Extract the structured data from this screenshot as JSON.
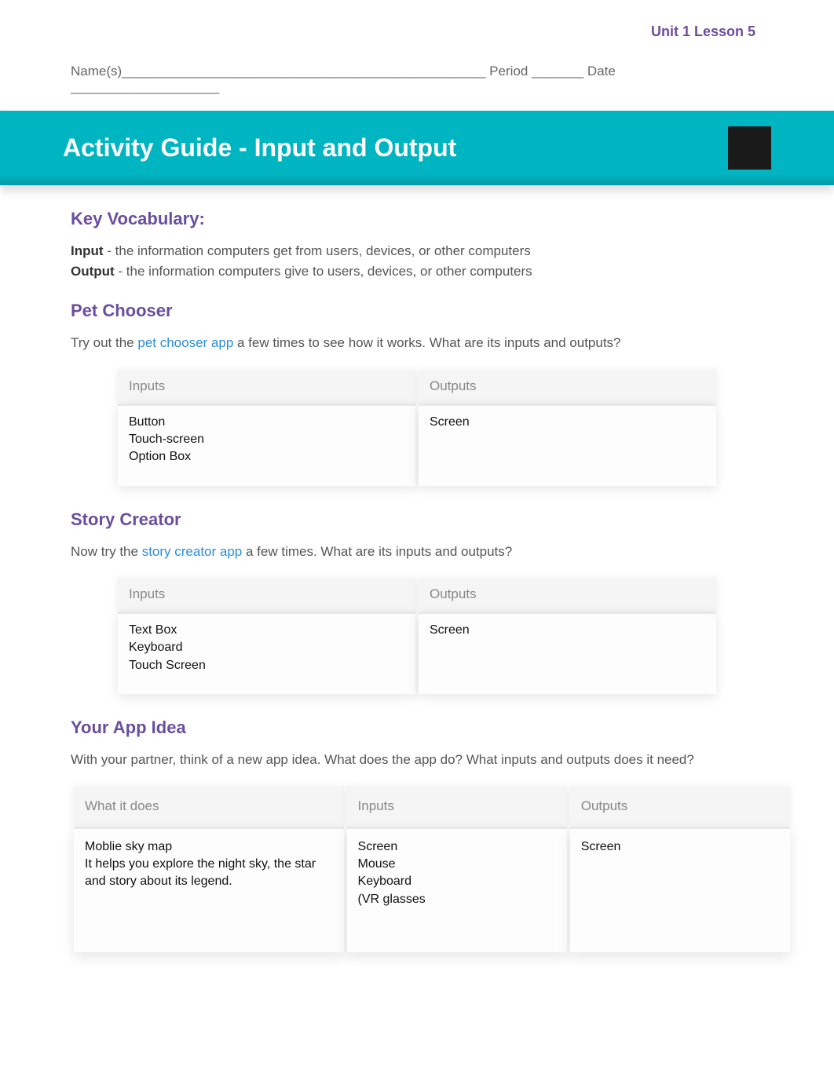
{
  "meta": {
    "unit_lesson": "Unit 1 Lesson 5",
    "name_line": "Name(s)_________________________________________________ Period _______ Date ____________________"
  },
  "title": "Activity Guide - Input and Output",
  "vocab": {
    "heading": "Key Vocabulary:",
    "input_term": "Input",
    "input_def": " - the information computers get from users, devices, or other computers",
    "output_term": "Output",
    "output_def": " - the information computers give to users, devices, or other computers"
  },
  "pet": {
    "heading": "Pet Chooser",
    "pre": "Try out the ",
    "link": "pet chooser app",
    "post": " a few times to see how it works. What are its inputs and outputs?",
    "inputs_header": "Inputs",
    "outputs_header": "Outputs",
    "inputs_body": "Button\nTouch-screen\nOption Box",
    "outputs_body": "Screen"
  },
  "story": {
    "heading": "Story Creator",
    "pre": "Now try the ",
    "link": "story creator app",
    "post": " a few times. What are its inputs and outputs?",
    "inputs_header": "Inputs",
    "outputs_header": "Outputs",
    "inputs_body": "Text Box\nKeyboard\nTouch Screen",
    "outputs_body": "Screen"
  },
  "idea": {
    "heading": "Your App Idea",
    "prompt": "With your partner, think of a new app idea. What does the app do? What inputs and outputs does it need?",
    "what_header": "What it does",
    "inputs_header": "Inputs",
    "outputs_header": "Outputs",
    "what_body": "Moblie  sky map\nIt helps you explore the night sky, the star and story about its legend.",
    "inputs_body": "Screen\nMouse\nKeyboard\n(VR glasses",
    "outputs_body": "Screen"
  }
}
